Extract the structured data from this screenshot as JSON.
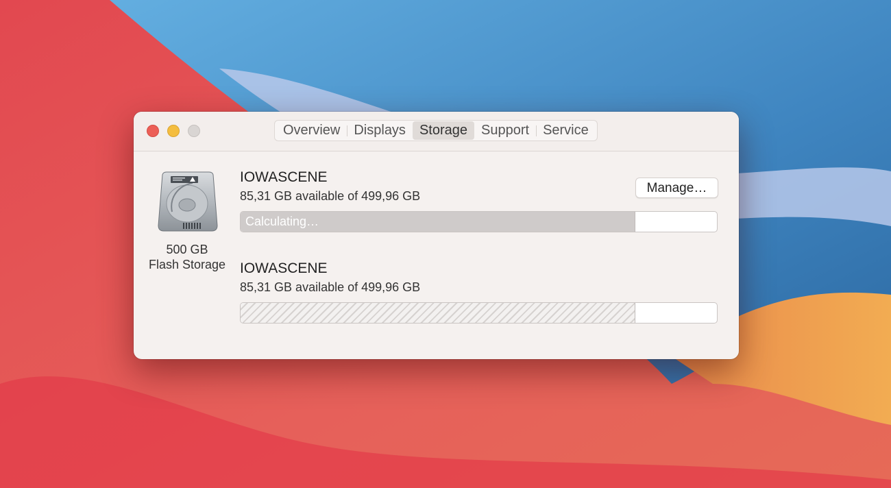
{
  "tabs": [
    {
      "label": "Overview",
      "active": false
    },
    {
      "label": "Displays",
      "active": false
    },
    {
      "label": "Storage",
      "active": true
    },
    {
      "label": "Support",
      "active": false
    },
    {
      "label": "Service",
      "active": false
    }
  ],
  "disk": {
    "icon": "hard-disk-icon",
    "size_label": "500 GB",
    "type_label": "Flash Storage"
  },
  "volumes": [
    {
      "name": "IOWASCENE",
      "available": "85,31 GB available of 499,96 GB",
      "bar_label": "Calculating…",
      "used_fraction": 0.829,
      "manage_label": "Manage…"
    },
    {
      "name": "IOWASCENE",
      "available": "85,31 GB available of 499,96 GB",
      "used_fraction": 0.829
    }
  ],
  "colors": {
    "close": "#ec5f57",
    "minimize": "#f4bd3f",
    "zoom": "#d9d5d3"
  }
}
